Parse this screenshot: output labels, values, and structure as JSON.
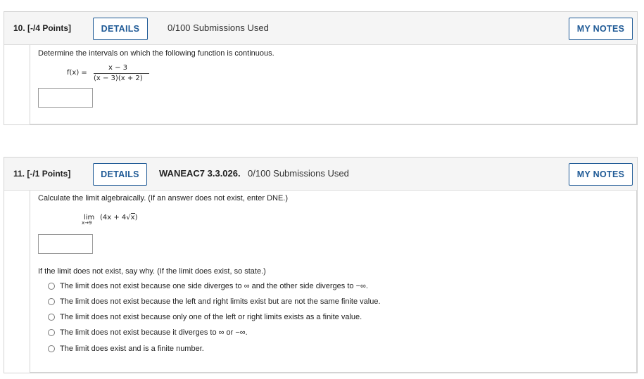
{
  "q10": {
    "number": "10. [-/4 Points]",
    "details_label": "DETAILS",
    "submissions": "0/100 Submissions Used",
    "notes_label": "MY NOTES",
    "prompt": "Determine the intervals on which the following function is continuous.",
    "fx_label": "f(x) =",
    "numerator": "x − 3",
    "denominator": "(x − 3)(x + 2)",
    "answer_value": ""
  },
  "q11": {
    "number": "11. [-/1 Points]",
    "details_label": "DETAILS",
    "code": "WANEAC7 3.3.026.",
    "submissions": "0/100 Submissions Used",
    "notes_label": "MY NOTES",
    "prompt": "Calculate the limit algebraically. (If an answer does not exist, enter DNE.)",
    "lim_word": "lim",
    "lim_sub": "x→9",
    "lim_expr_start": "(4x + 4",
    "lim_expr_rad": "x",
    "lim_expr_end": ")",
    "answer_value": "",
    "why_prompt": "If the limit does not exist, say why. (If the limit does exist, so state.)",
    "options": [
      "The limit does not exist because one side diverges to ∞ and the other side diverges to −∞.",
      "The limit does not exist because the left and right limits exist but are not the same finite value.",
      "The limit does not exist because only one of the left or right limits exists as a finite value.",
      "The limit does not exist because it diverges to ∞ or −∞.",
      "The limit does exist and is a finite number."
    ]
  }
}
